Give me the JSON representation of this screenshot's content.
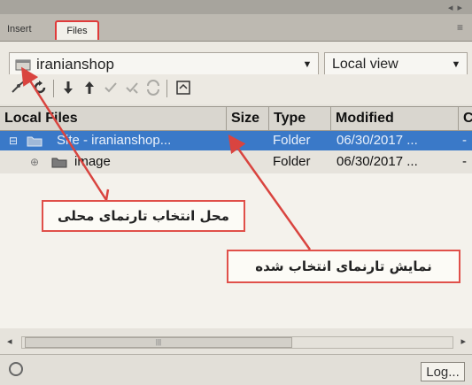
{
  "panel": {
    "tabs": [
      {
        "label": "Insert",
        "active": false
      },
      {
        "label": "Files",
        "active": true
      }
    ]
  },
  "toolbar": {
    "site_name": "iranianshop",
    "view_mode": "Local view"
  },
  "table": {
    "headers": [
      "Local Files",
      "Size",
      "Type",
      "Modified",
      "C"
    ],
    "rows": [
      {
        "name": "Site - iranianshop...",
        "size": "",
        "type": "Folder",
        "modified": "06/30/2017 ...",
        "checked": "-",
        "selected": true
      },
      {
        "name": "image",
        "size": "",
        "type": "Folder",
        "modified": "06/30/2017 ...",
        "checked": "-",
        "selected": false
      }
    ]
  },
  "annotations": {
    "local_site_selector": "محل انتخاب تارنمای محلی",
    "selected_site_display": "نمایش تارنمای انتخاب شده"
  },
  "status": {
    "log_button": "Log..."
  },
  "colors": {
    "selection": "#3a79c8",
    "callout_border": "#e0504a",
    "panel_bg": "#ece9e2"
  }
}
